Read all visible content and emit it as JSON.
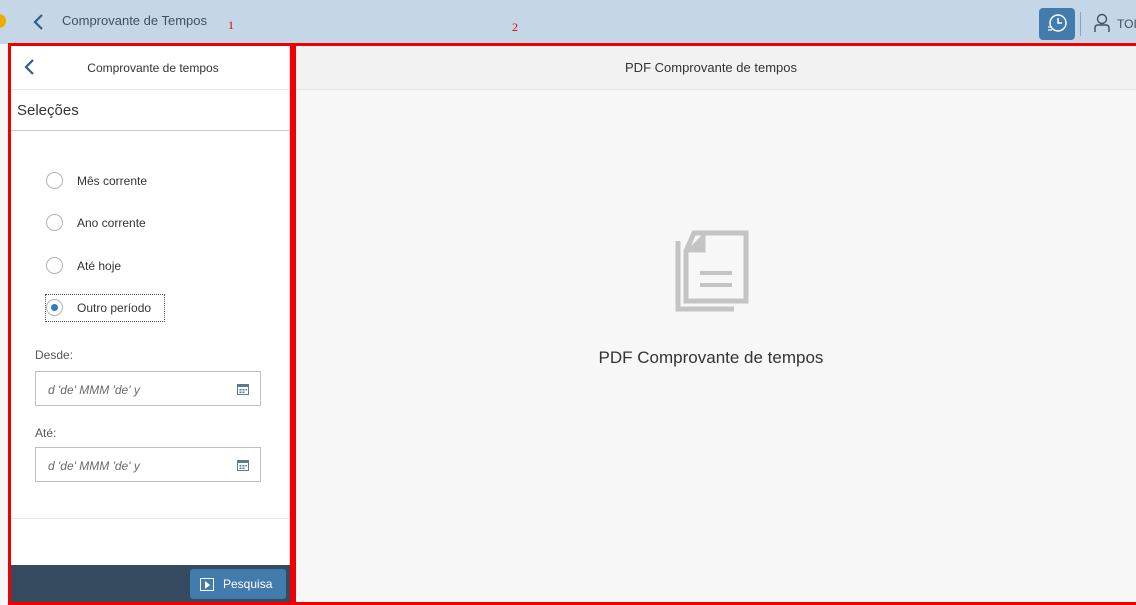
{
  "shell": {
    "title": "Comprovante de Tempos",
    "marker_1": "1",
    "marker_2": "2",
    "user_name": "TOI"
  },
  "left_panel": {
    "title": "Comprovante de tempos",
    "section_title": "Seleções",
    "radios": [
      {
        "label": "Mês corrente",
        "selected": false
      },
      {
        "label": "Ano corrente",
        "selected": false
      },
      {
        "label": "Até hoje",
        "selected": false
      },
      {
        "label": "Outro período",
        "selected": true
      }
    ],
    "from_label": "Desde:",
    "from_placeholder": "d 'de' MMM 'de' y",
    "to_label": "Até:",
    "to_placeholder": "d 'de' MMM 'de' y",
    "search_button": "Pesquisa"
  },
  "right_panel": {
    "title": "PDF Comprovante de tempos",
    "message": "PDF Comprovante de tempos"
  },
  "colors": {
    "shell_bg": "#c5d6e6",
    "accent": "#427cac",
    "footer_bg": "#354a5f",
    "highlight_red": "#e00000"
  }
}
